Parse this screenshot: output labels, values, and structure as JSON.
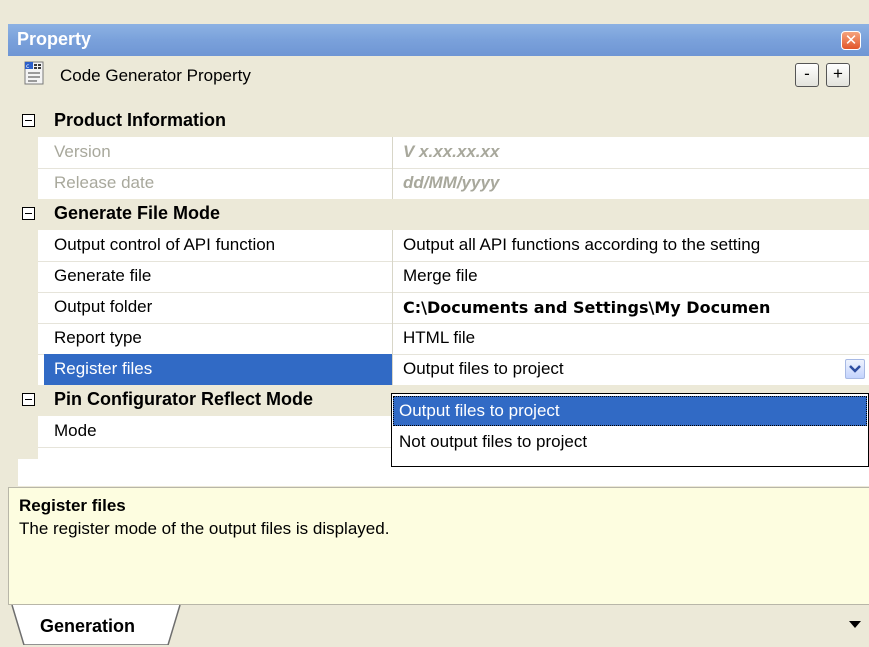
{
  "window": {
    "title": "Property",
    "close_icon": "close-icon"
  },
  "header": {
    "title": "Code Generator Property",
    "collapse_label": "-",
    "expand_label": "+",
    "icon": "code-generator-icon"
  },
  "grid": {
    "rows": [
      {
        "type": "category",
        "label": "Product Information"
      },
      {
        "type": "property",
        "name": "Version",
        "value": "V x.xx.xx.xx",
        "disabled": true
      },
      {
        "type": "property",
        "name": "Release date",
        "value": "dd/MM/yyyy",
        "disabled": true
      },
      {
        "type": "category",
        "label": "Generate File Mode"
      },
      {
        "type": "property",
        "name": "Output control of API function",
        "value": "Output all API functions according to the setting"
      },
      {
        "type": "property",
        "name": "Generate file",
        "value": "Merge file"
      },
      {
        "type": "property",
        "name": "Output folder",
        "value": "C:\\Documents and Settings\\My Documen"
      },
      {
        "type": "property",
        "name": "Report type",
        "value": "HTML file"
      },
      {
        "type": "property",
        "name": "Register files",
        "value": "Output files to project",
        "selected": true
      },
      {
        "type": "category",
        "label": "Pin Configurator Reflect Mode"
      },
      {
        "type": "property",
        "name": "Mode",
        "value": ""
      }
    ]
  },
  "dropdown": {
    "options": [
      "Output files to project",
      "Not output files to project"
    ],
    "selected_index": 0
  },
  "description": {
    "title": "Register files",
    "text": "The register mode of the output files is displayed."
  },
  "tabs": [
    {
      "label": "Generation",
      "active": true
    }
  ],
  "colors": {
    "title_bar": "#7aa1db",
    "selection": "#316ac5",
    "description_bg": "#fdfde0",
    "panel_bg": "#ece9d8"
  }
}
